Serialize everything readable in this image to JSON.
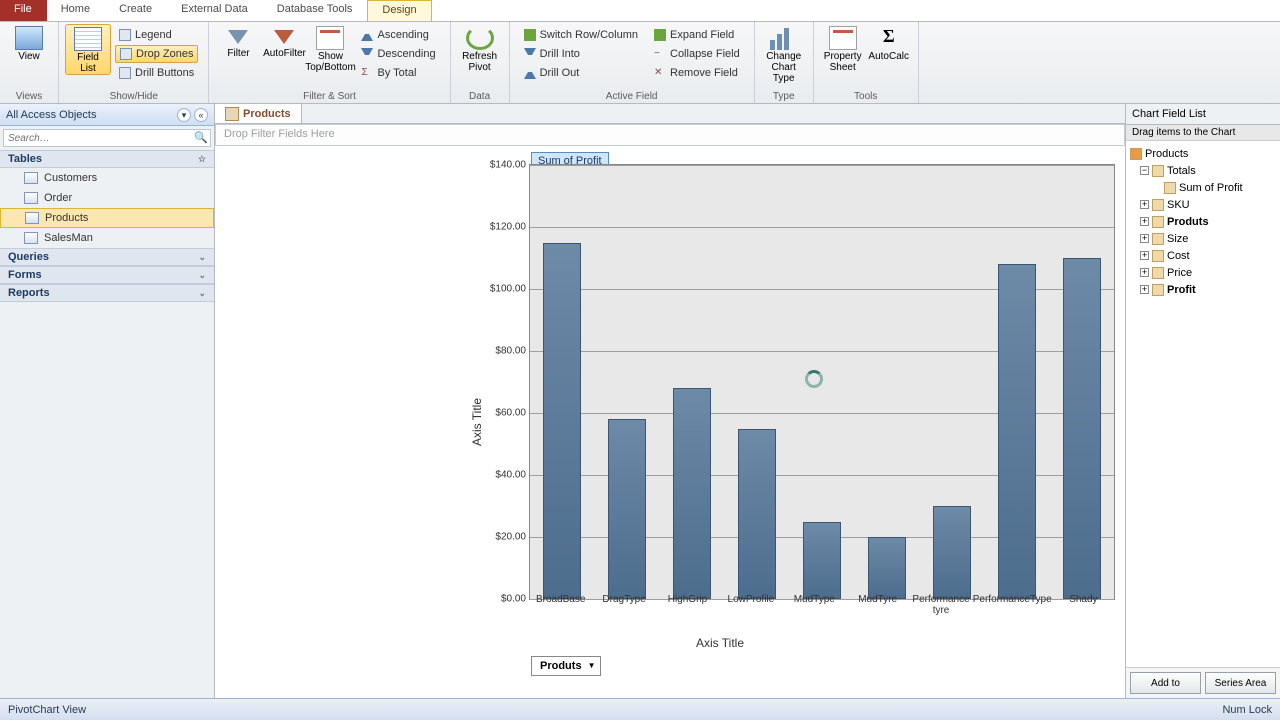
{
  "tabs": {
    "file": "File",
    "home": "Home",
    "create": "Create",
    "external": "External Data",
    "dbtools": "Database Tools",
    "design": "Design"
  },
  "ribbon": {
    "views": {
      "view": "View",
      "label": "Views"
    },
    "showhide": {
      "fieldlist": "Field\nList",
      "legend": "Legend",
      "dropzones": "Drop Zones",
      "drillbuttons": "Drill Buttons",
      "label": "Show/Hide"
    },
    "filtersort": {
      "filter": "Filter",
      "autofilter": "AutoFilter",
      "showtop": "Show\nTop/Bottom",
      "asc": "Ascending",
      "desc": "Descending",
      "bytotal": "By Total",
      "label": "Filter & Sort"
    },
    "data": {
      "refresh": "Refresh\nPivot",
      "label": "Data"
    },
    "activefield": {
      "switch": "Switch Row/Column",
      "drillinto": "Drill Into",
      "drillout": "Drill Out",
      "expand": "Expand Field",
      "collapse": "Collapse Field",
      "remove": "Remove Field",
      "label": "Active Field"
    },
    "type": {
      "change": "Change\nChart Type",
      "label": "Type"
    },
    "tools": {
      "property": "Property\nSheet",
      "autocalc": "AutoCalc",
      "label": "Tools"
    }
  },
  "nav": {
    "header": "All Access Objects",
    "search_ph": "Search…",
    "tables_hdr": "Tables",
    "tables": [
      "Customers",
      "Order",
      "Products",
      "SalesMan"
    ],
    "queries": "Queries",
    "forms": "Forms",
    "reports": "Reports"
  },
  "doc_tab": "Products",
  "dropzone": "Drop Filter Fields Here",
  "legend": "Sum of Profit",
  "y_title": "Axis Title",
  "x_title": "Axis Title",
  "category_dd": "Produts",
  "cfl": {
    "title": "Chart Field List",
    "sub": "Drag items to the Chart",
    "root": "Products",
    "totals": "Totals",
    "sumprofit": "Sum of Profit",
    "fields": [
      "SKU",
      "Produts",
      "Size",
      "Cost",
      "Price",
      "Profit"
    ],
    "addto": "Add to",
    "series": "Series Area"
  },
  "status": {
    "view": "PivotChart View",
    "numlock": "Num Lock"
  },
  "chart_data": {
    "type": "bar",
    "title": "Sum of Profit",
    "xlabel": "Axis Title",
    "ylabel": "Axis Title",
    "ylim": [
      0,
      140
    ],
    "yticks": [
      0,
      20,
      40,
      60,
      80,
      100,
      120,
      140
    ],
    "ytick_labels": [
      "$0.00",
      "$20.00",
      "$40.00",
      "$60.00",
      "$80.00",
      "$100.00",
      "$120.00",
      "$140.00"
    ],
    "categories": [
      "BroadBase",
      "DragType",
      "HighGrip",
      "LowProfile",
      "MudType",
      "MudTyre",
      "Performance tyre",
      "PerformanceType",
      "Shady"
    ],
    "values": [
      115,
      58,
      68,
      55,
      25,
      20,
      30,
      108,
      110
    ]
  }
}
